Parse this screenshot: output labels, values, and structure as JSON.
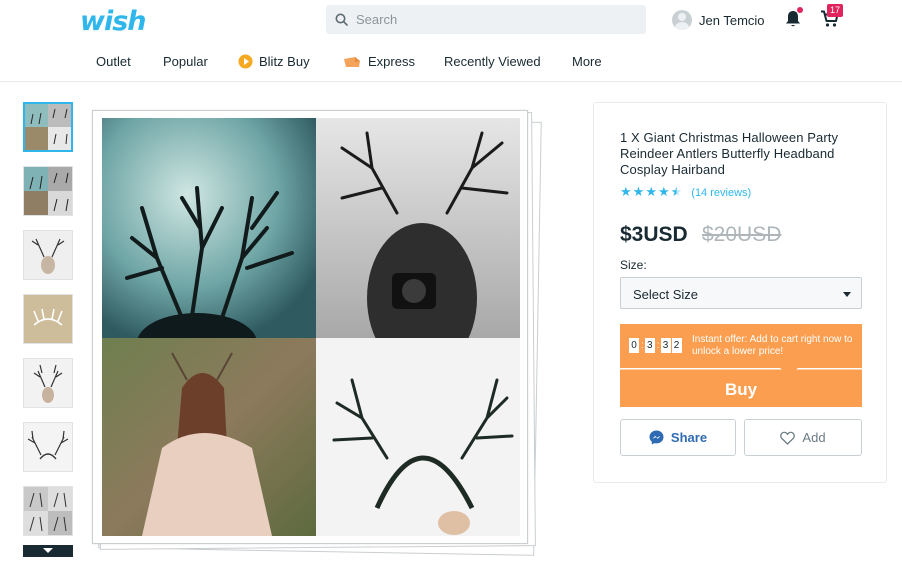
{
  "header": {
    "logo": "wish",
    "search_placeholder": "Search",
    "user_name": "Jen Temcio",
    "cart_count": "17"
  },
  "nav": {
    "items": [
      {
        "label": "Outlet"
      },
      {
        "label": "Popular"
      },
      {
        "label": "Blitz Buy",
        "icon": "blitz-buy-icon"
      },
      {
        "label": "Express",
        "icon": "express-icon"
      },
      {
        "label": "Recently Viewed"
      },
      {
        "label": "More"
      }
    ]
  },
  "gallery": {
    "thumbnail_count": 7,
    "selected_index": 0
  },
  "product": {
    "title": "1 X Giant Christmas Halloween Party Reindeer Antlers Butterfly Headband Cosplay Hairband",
    "rating": 4.5,
    "reviews": "(14 reviews)",
    "price": "$3USD",
    "original_price": "$20USD",
    "size_label": "Size:",
    "size_selected": "Select Size",
    "timer_digits": [
      "0",
      "3",
      "3",
      "2"
    ],
    "offer_text": "Instant offer: Add to cart right now to unlock a lower price!",
    "buy_label": "Buy",
    "share_label": "Share",
    "add_label": "Add"
  },
  "colors": {
    "brand": "#2fb7ec",
    "buy": "#fb9e4f",
    "badge": "#e0245e",
    "text": "#192a32"
  }
}
